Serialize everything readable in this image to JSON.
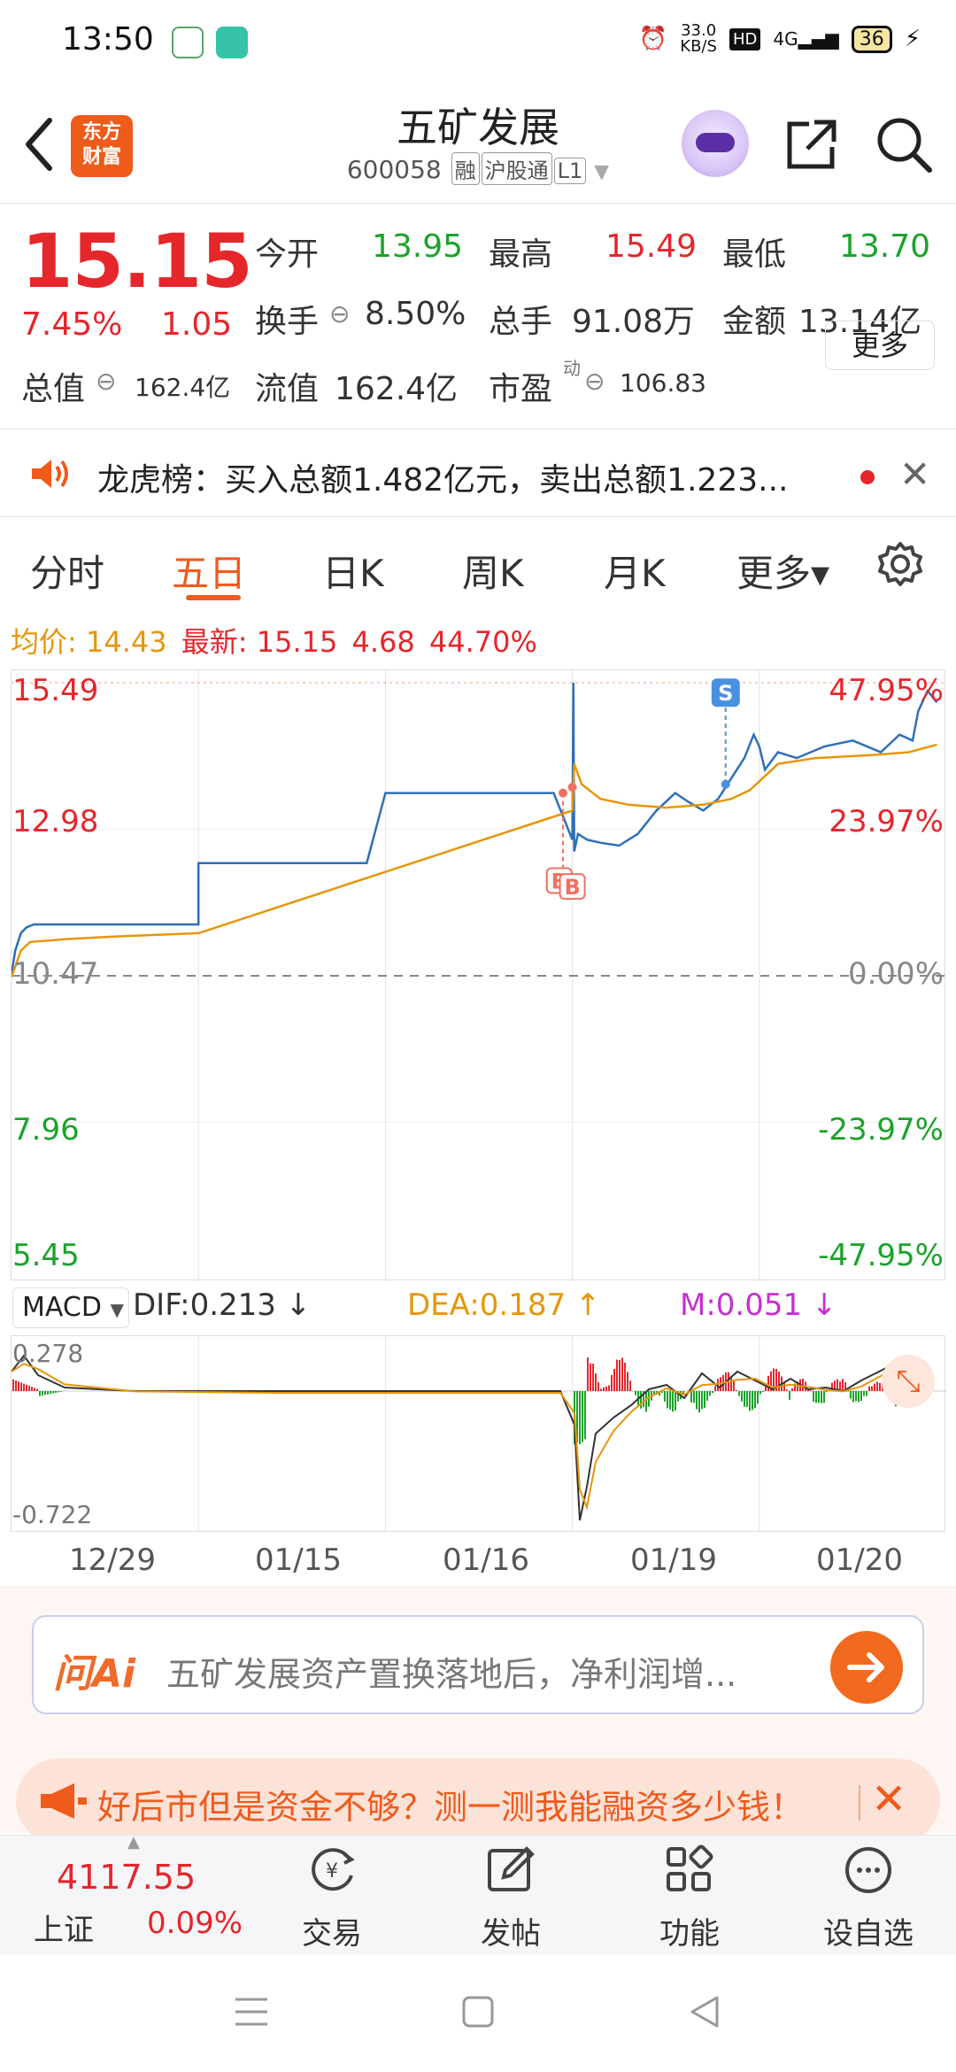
{
  "status_bar": {
    "time": "13:50",
    "net_speed": "33.0",
    "net_unit": "KB/S",
    "hd": "HD",
    "signal": "4G",
    "battery": "36"
  },
  "header": {
    "logo_line1": "东方",
    "logo_line2": "财富",
    "title": "五矿发展",
    "code": "600058",
    "tags": [
      "融",
      "沪股通",
      "L1"
    ]
  },
  "quote": {
    "price": "15.15",
    "change_pct": "7.45%",
    "change": "1.05",
    "open_label": "今开",
    "open": "13.95",
    "high_label": "最高",
    "high": "15.49",
    "low_label": "最低",
    "low": "13.70",
    "turnover_label": "换手",
    "turnover": "8.50%",
    "volume_label": "总手",
    "volume": "91.08万",
    "amount_label": "金额",
    "amount": "13.14亿",
    "mktcap_label": "总值",
    "mktcap": "162.4亿",
    "float_label": "流值",
    "float_cap": "162.4亿",
    "pe_label": "市盈",
    "pe_sup": "动",
    "pe": "106.83",
    "more_label": "更多"
  },
  "dragon_tiger": {
    "text": "龙虎榜：买入总额1.482亿元，卖出总额1.223..."
  },
  "tabs": [
    "分时",
    "五日",
    "日K",
    "周K",
    "月K",
    "更多▾"
  ],
  "active_tab": 1,
  "infobar": {
    "avg_label": "均价:",
    "avg": "14.43",
    "last_label": "最新:",
    "last": "15.15",
    "chg": "4.68",
    "chg_pct": "44.70%"
  },
  "chart_data": {
    "type": "line",
    "y_left_ticks": [
      "15.49",
      "12.98",
      "10.47",
      "7.96",
      "5.45"
    ],
    "y_right_ticks": [
      "47.95%",
      "23.97%",
      "0.00%",
      "-23.97%",
      "-47.95%"
    ],
    "ylim": [
      5.45,
      15.49
    ],
    "x_dates": [
      "12/29",
      "01/15",
      "01/16",
      "01/19",
      "01/20"
    ],
    "grid": true,
    "markers": [
      "B",
      "B",
      "S"
    ],
    "series": [
      {
        "name": "price",
        "color": "#2e6fb8",
        "x": [
          0,
          0.02,
          0.05,
          0.08,
          0.12,
          0.2,
          0.5,
          0.9,
          1.0,
          1.0,
          1.9,
          2.0,
          2.9,
          3.0,
          3.005,
          3.01,
          3.03,
          3.08,
          3.15,
          3.25,
          3.35,
          3.45,
          3.55,
          3.62,
          3.7,
          3.78,
          3.85,
          3.92,
          3.97,
          4.0,
          4.03,
          4.1,
          4.2,
          4.35,
          4.5,
          4.65,
          4.75,
          4.82,
          4.85,
          4.9,
          4.95
        ],
        "values": [
          10.5,
          10.9,
          11.2,
          11.3,
          11.35,
          11.35,
          11.35,
          11.35,
          11.35,
          12.4,
          12.4,
          13.6,
          13.6,
          12.8,
          15.49,
          12.6,
          12.9,
          12.8,
          12.75,
          12.7,
          12.9,
          13.3,
          13.6,
          13.45,
          13.3,
          13.5,
          13.85,
          14.2,
          14.6,
          14.4,
          14.0,
          14.3,
          14.2,
          14.4,
          14.5,
          14.3,
          14.6,
          14.5,
          15.0,
          15.35,
          15.15
        ]
      },
      {
        "name": "avg",
        "color": "#e6960a",
        "x": [
          0,
          0.05,
          0.1,
          0.3,
          0.6,
          1.0,
          3.0,
          3.01,
          3.05,
          3.15,
          3.3,
          3.5,
          3.7,
          3.85,
          3.95,
          4.0,
          4.1,
          4.3,
          4.6,
          4.8,
          4.95
        ],
        "values": [
          10.45,
          10.9,
          11.05,
          11.1,
          11.15,
          11.2,
          13.3,
          14.1,
          13.75,
          13.5,
          13.4,
          13.35,
          13.4,
          13.5,
          13.65,
          13.8,
          14.1,
          14.2,
          14.25,
          14.3,
          14.43
        ]
      }
    ]
  },
  "macd": {
    "label": "MACD",
    "dif_label": "DIF:0.213",
    "dea_label": "DEA:0.187",
    "m_label": "M:0.051",
    "y_top": "0.278",
    "y_bottom": "-0.722"
  },
  "ai": {
    "logo": "问Ai",
    "question": "五矿发展资产置换落地后，净利润增..."
  },
  "promo": {
    "text": "好后市但是资金不够？测一测我能融资多少钱！"
  },
  "bottom_nav": {
    "index_value": "4117.55",
    "index_name": "上证",
    "index_pct": "0.09%",
    "items": [
      "交易",
      "发帖",
      "功能",
      "设自选"
    ]
  },
  "colors": {
    "up": "#e5262b",
    "down": "#1aa329",
    "accent": "#ef5b1a",
    "avg_line": "#e6960a",
    "price_line": "#2e6fb8"
  }
}
